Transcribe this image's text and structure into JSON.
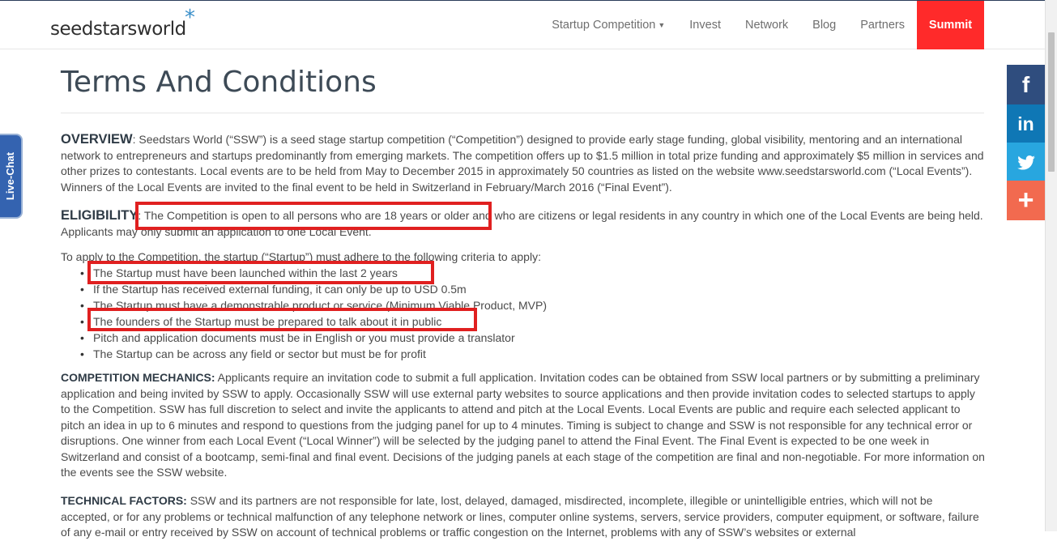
{
  "nav": {
    "logo": "seedstarsworld",
    "logo_star": "*",
    "links": [
      "Startup Competition",
      "Invest",
      "Network",
      "Blog",
      "Partners"
    ],
    "summit": "Summit"
  },
  "livechat": "Live-Chat",
  "social": {
    "facebook": "f",
    "linkedin": "in",
    "twitter": "twitter-icon",
    "plus": "+"
  },
  "page": {
    "title": "Terms And Conditions",
    "overview_head": "OVERVIEW",
    "overview_text": ": Seedstars World (“SSW”) is a seed stage startup competition (“Competition”) designed to provide early stage funding, global visibility, mentoring and an international network to entrepreneurs and startups predominantly from emerging markets. The competition offers up to $1.5 million in total prize funding and approximately $5 million in services and other prizes to contestants. Local events are to be held from May to December 2015 in approximately 50 countries as listed on the website www.seedstarsworld.com (“Local Events”). Winners of the Local Events are invited to the final event to be held in Switzerland in February/March 2016 (“Final Event”).",
    "eligibility_head": "ELIGIBILITY",
    "eligibility_text": ": The Competition is open to all persons who are 18 years or older and who are citizens or legal residents in any country in which one of the Local Events are being held. Applicants may only submit an application to one Local Event.",
    "criteria_intro": "To apply to the Competition, the startup (“Startup”) must adhere to the following criteria to apply:",
    "criteria": [
      "The Startup must have been launched within the last 2 years",
      "If the Startup has received external funding, it can only be up to USD 0.5m",
      "The Startup must have a demonstrable product or service (Minimum Viable Product, MVP)",
      "The founders of the Startup must be prepared to talk about it in public",
      "Pitch and application documents must be in English or you must provide a translator",
      "The Startup can be across any field or sector but must be for profit"
    ],
    "mechanics_head": "COMPETITION MECHANICS:",
    "mechanics_text": " Applicants require an invitation code to submit a full application. Invitation codes can be obtained from SSW local partners or by submitting a preliminary application and being invited by SSW to apply. Occasionally SSW will use external party websites to source applications and then provide invitation codes to selected startups to apply to the Competition. SSW has full discretion to select and invite the applicants to attend and pitch at the Local Events. Local Events are public and require each selected applicant to pitch an idea in up to 6 minutes and respond to questions from the judging panel for up to 4 minutes. Timing is subject to change and SSW is not responsible for any technical error or disruptions. One winner from each Local Event (“Local Winner”) will be selected by the judging panel to attend the Final Event. The Final Event is expected to be one week in Switzerland and consist of a bootcamp, semi-final and final event. Decisions of the judging panels at each stage of the competition are final and non-negotiable. For more information on the events see the SSW website.",
    "technical_head": "TECHNICAL FACTORS:",
    "technical_text": " SSW and its partners are not responsible for late, lost, delayed, damaged, misdirected, incomplete, illegible or unintelligible entries, which will not be accepted, or for any problems or technical malfunction of any telephone network or lines, computer online systems, servers, service providers, computer equipment, or software, failure of any e-mail or entry received by SSW on account of technical problems or traffic congestion on the Internet, problems with any of SSW’s websites or external"
  },
  "colors": {
    "summit_bg": "#ff2a2a",
    "highlight": "#e02020",
    "facebook": "#2f4d7e",
    "linkedin": "#0f77b5",
    "twitter": "#28a6df",
    "plus": "#f26a4f",
    "livechat": "#3463b0"
  }
}
